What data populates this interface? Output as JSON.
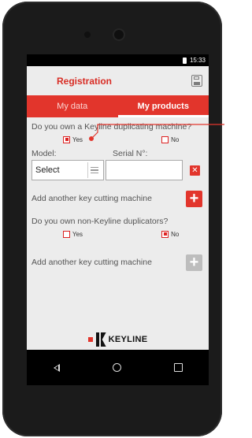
{
  "status_bar": {
    "time": "15:33"
  },
  "app_bar": {
    "title": "Registration",
    "save_icon": "save-icon"
  },
  "tabs": [
    {
      "label": "My data",
      "active": false
    },
    {
      "label": "My products",
      "active": true
    }
  ],
  "question1": {
    "text": "Do you own a Keyline duplicating machine?",
    "yes_label": "Yes",
    "no_label": "No",
    "selected": "Yes"
  },
  "machine_row": {
    "model_label": "Model:",
    "serial_label": "Serial N°:",
    "select_value": "Select",
    "serial_value": ""
  },
  "add_keyline_label": "Add another key cutting machine",
  "question2": {
    "text": "Do you own non-Keyline duplicators?",
    "yes_label": "Yes",
    "no_label": "No",
    "selected": "No"
  },
  "add_other_label": "Add another key cutting machine",
  "logo": {
    "text": "KEYLINE"
  },
  "colors": {
    "accent": "#e2352c",
    "disabled": "#bdbdbd"
  }
}
